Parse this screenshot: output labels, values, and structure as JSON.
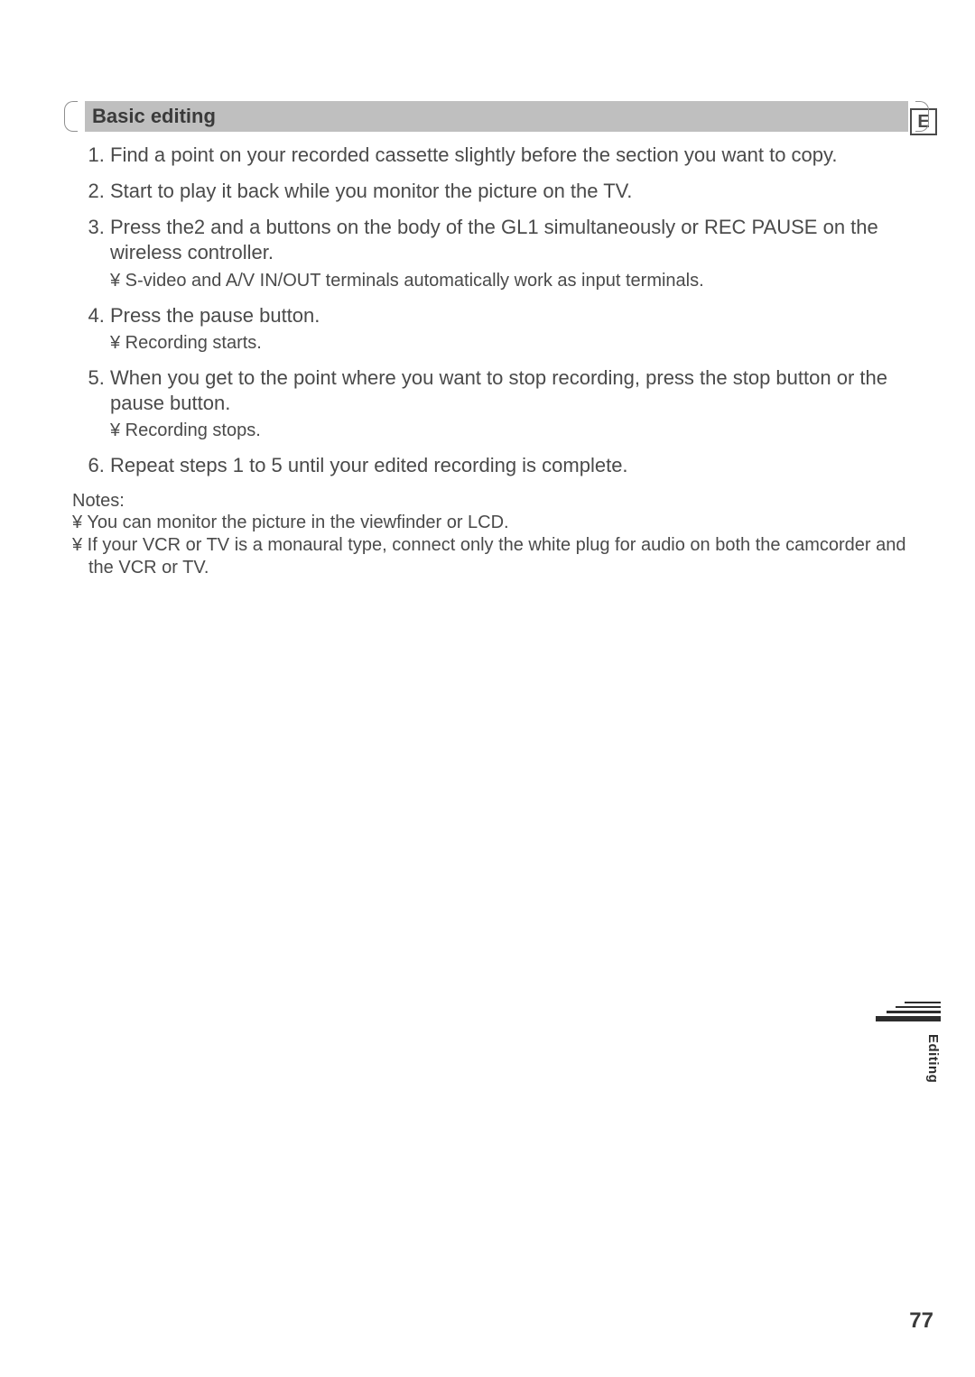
{
  "lang_badge": "E",
  "section_title": "Basic editing",
  "steps": [
    {
      "text": "Find a point on your recorded cassette slightly before the section you want to copy."
    },
    {
      "text": "Start to play it back while you monitor the picture on the TV."
    },
    {
      "text": "Press the2  and a  buttons on the body of the GL1 simultaneously or REC PAUSE on the wireless controller.",
      "sub": "¥  S-video and A/V IN/OUT terminals automatically work as input terminals."
    },
    {
      "text": "Press the pause button.",
      "sub": "¥  Recording starts."
    },
    {
      "text": "When you get to the point where you want to stop recording, press the stop button or the pause button.",
      "sub": "¥  Recording stops."
    },
    {
      "text": "Repeat steps 1 to 5 until your edited recording is complete."
    }
  ],
  "notes_head": "Notes:",
  "notes": [
    "¥  You can monitor the picture in the viewfinder or LCD.",
    "¥  If your VCR or TV is a monaural type, connect only the white plug for audio on both the camcorder and the VCR or TV."
  ],
  "side_label": "Editing",
  "page_number": "77"
}
